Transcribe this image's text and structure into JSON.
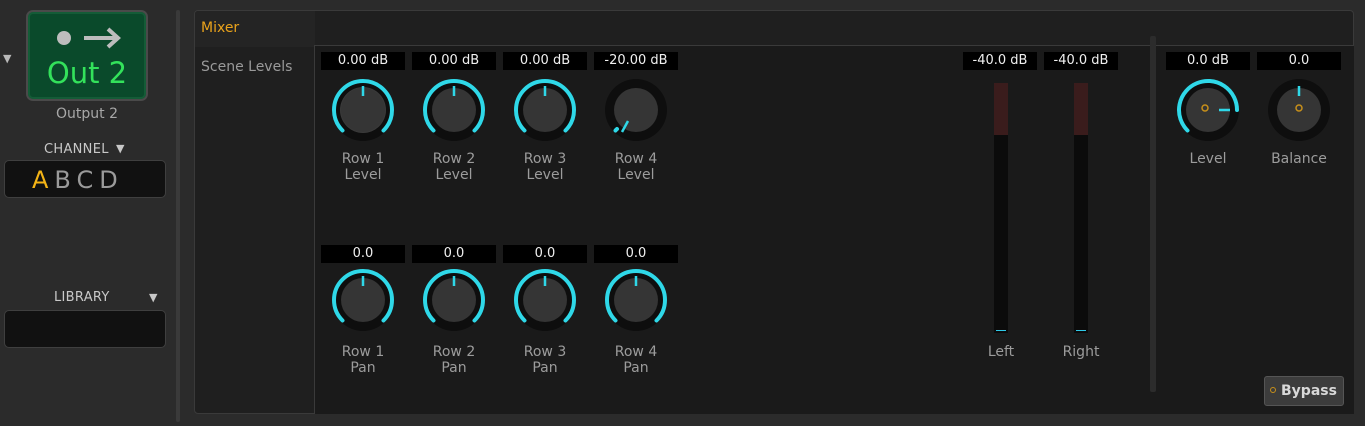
{
  "output": {
    "badge_text": "Out 2",
    "name": "Output 2"
  },
  "channel": {
    "title": "CHANNEL",
    "letters": [
      "A",
      "B",
      "C",
      "D"
    ],
    "active": "A"
  },
  "library": {
    "title": "LIBRARY",
    "value": ""
  },
  "tabs": {
    "mixer": "Mixer",
    "scene_levels": "Scene Levels"
  },
  "row_levels": [
    {
      "value": "0.00 dB",
      "label_line1": "Row 1",
      "label_line2": "Level"
    },
    {
      "value": "0.00 dB",
      "label_line1": "Row 2",
      "label_line2": "Level"
    },
    {
      "value": "0.00 dB",
      "label_line1": "Row 3",
      "label_line2": "Level"
    },
    {
      "value": "-20.00 dB",
      "label_line1": "Row 4",
      "label_line2": "Level"
    }
  ],
  "row_pans": [
    {
      "value": "0.0",
      "label_line1": "Row 1",
      "label_line2": "Pan"
    },
    {
      "value": "0.0",
      "label_line1": "Row 2",
      "label_line2": "Pan"
    },
    {
      "value": "0.0",
      "label_line1": "Row 3",
      "label_line2": "Pan"
    },
    {
      "value": "0.0",
      "label_line1": "Row 4",
      "label_line2": "Pan"
    }
  ],
  "meters": [
    {
      "value": "-40.0 dB",
      "label": "Left"
    },
    {
      "value": "-40.0 dB",
      "label": "Right"
    }
  ],
  "output_controls": [
    {
      "value": "0.0 dB",
      "label": "Level"
    },
    {
      "value": "0.0",
      "label": "Balance"
    }
  ],
  "bypass": {
    "label": "Bypass"
  },
  "colors": {
    "accent": "#2fd8e8",
    "active_letter": "#f4b416",
    "tab_active": "#e9a21b",
    "badge_text": "#33e25b"
  }
}
